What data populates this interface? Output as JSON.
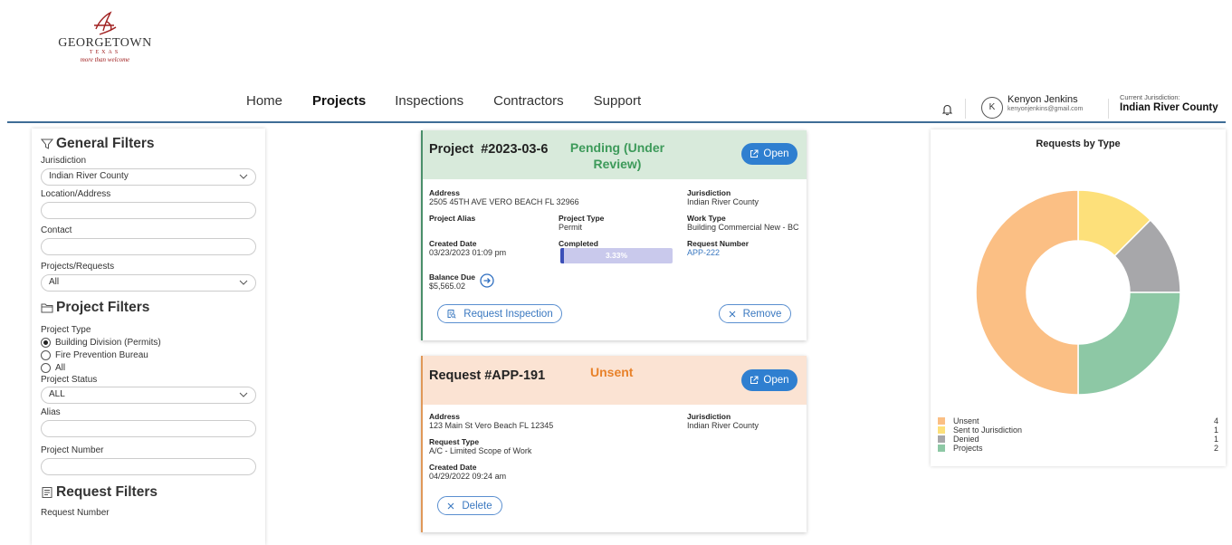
{
  "logo": {
    "brand": "GEORGETOWN",
    "sub": "TEXAS",
    "tagline": "more than welcome"
  },
  "nav": [
    {
      "label": "Home",
      "active": false
    },
    {
      "label": "Projects",
      "active": true
    },
    {
      "label": "Inspections",
      "active": false
    },
    {
      "label": "Contractors",
      "active": false
    },
    {
      "label": "Support",
      "active": false
    }
  ],
  "user": {
    "initial": "K",
    "name": "Kenyon Jenkins",
    "email": "kenyonjenkins@gmail.com"
  },
  "jurisdiction": {
    "label": "Current Jurisdiction:",
    "value": "Indian River County"
  },
  "filters": {
    "general_title": "General Filters",
    "jurisdiction_label": "Jurisdiction",
    "jurisdiction_value": "Indian River County",
    "location_label": "Location/Address",
    "location_value": "",
    "contact_label": "Contact",
    "contact_value": "",
    "projreq_label": "Projects/Requests",
    "projreq_value": "All",
    "project_title": "Project Filters",
    "project_type_label": "Project Type",
    "project_type_options": [
      "Building Division (Permits)",
      "Fire Prevention Bureau",
      "All"
    ],
    "project_type_selected": "Building Division (Permits)",
    "status_label": "Project Status",
    "status_value": "ALL",
    "alias_label": "Alias",
    "alias_value": "",
    "number_label": "Project Number",
    "number_value": "",
    "request_title": "Request Filters",
    "request_number_label": "Request Number"
  },
  "project_card": {
    "title": "Project  #2023-03-6",
    "status": "Pending (Under Review)",
    "open_label": "Open",
    "address_label": "Address",
    "address": "2505 45TH AVE VERO BEACH FL 32966",
    "jurisdiction_label": "Jurisdiction",
    "jurisdiction": "Indian River County",
    "alias_label": "Project Alias",
    "alias": "",
    "type_label": "Project Type",
    "type": "Permit",
    "work_type_label": "Work Type",
    "work_type": "Building Commercial New - BC",
    "created_label": "Created Date",
    "created": "03/23/2023 01:09 pm",
    "completed_label": "Completed",
    "completed_text": "3.33%",
    "completed_fraction": 0.0333,
    "request_number_label": "Request Number",
    "request_number": "APP-222",
    "balance_label": "Balance Due",
    "balance": "$5,565.02",
    "request_inspection_label": "Request Inspection",
    "remove_label": "Remove"
  },
  "request_card": {
    "title": "Request #APP-191",
    "status": "Unsent",
    "open_label": "Open",
    "address_label": "Address",
    "address": "123 Main St Vero Beach FL 12345",
    "jurisdiction_label": "Jurisdiction",
    "jurisdiction": "Indian River County",
    "type_label": "Request Type",
    "type": "A/C - Limited Scope of Work",
    "created_label": "Created Date",
    "created": "04/29/2022 09:24 am",
    "delete_label": "Delete"
  },
  "chart_data": {
    "type": "pie",
    "title": "Requests by Type",
    "donut": true,
    "legend_position": "bottom",
    "categories": [
      "Unsent",
      "Sent to Jurisdiction",
      "Denied",
      "Projects"
    ],
    "values": [
      4,
      1,
      1,
      2
    ],
    "colors": [
      "#fbbf84",
      "#fde07a",
      "#a7a7aa",
      "#8dc8a5"
    ]
  }
}
